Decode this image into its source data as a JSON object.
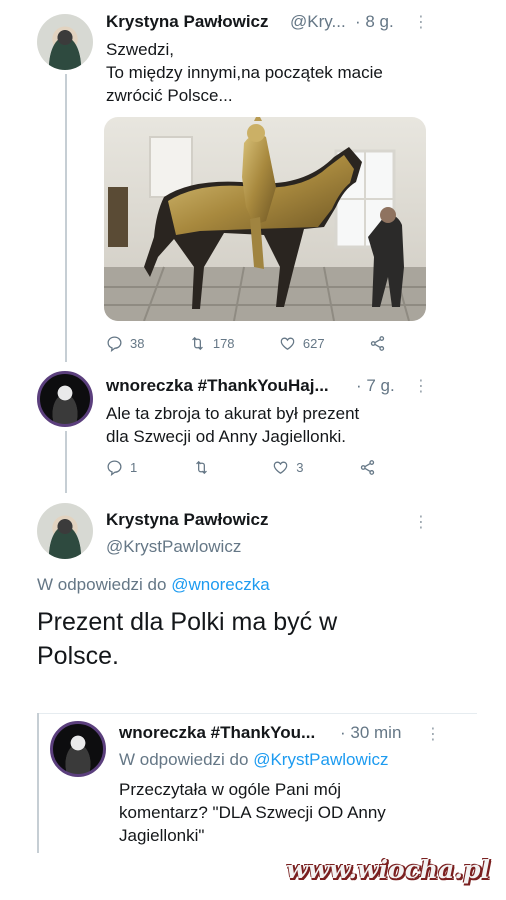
{
  "tweets": [
    {
      "name": "Krystyna Pawłowicz",
      "handle": "@Kry...",
      "time": "· 8 g.",
      "text": "Szwedzi,\nTo między innymi,na początek macie\nzwrócić Polsce...",
      "actions": {
        "reply": "38",
        "retweet": "178",
        "like": "627"
      }
    },
    {
      "name": "wnoreczka #ThankYouHaj...",
      "time": "· 7 g.",
      "text": "Ale ta zbroja to akurat był prezent\ndla Szwecji od Anny Jagiellonki.",
      "actions": {
        "reply": "1",
        "retweet": "",
        "like": "3"
      }
    }
  ],
  "main_tweet": {
    "name": "Krystyna Pawłowicz",
    "handle": "@KrystPawlowicz",
    "reply_prefix": "W odpowiedzi do",
    "reply_to": "@wnoreczka",
    "text": "Prezent dla Polki ma być w\nPolsce."
  },
  "reply_tweet": {
    "name": "wnoreczka #ThankYou...",
    "time": "· 30 min",
    "reply_prefix": "W odpowiedzi do",
    "reply_to": "@KrystPawlowicz",
    "text": "Przeczytała w ogóle Pani mój\nkomentarz? \"DLA Szwecji OD Anny\nJagiellonki\""
  },
  "watermark": "www.wiocha.pl",
  "colors": {
    "link": "#1d9bf0",
    "secondary": "#657786",
    "thread": "#c6ced4"
  }
}
